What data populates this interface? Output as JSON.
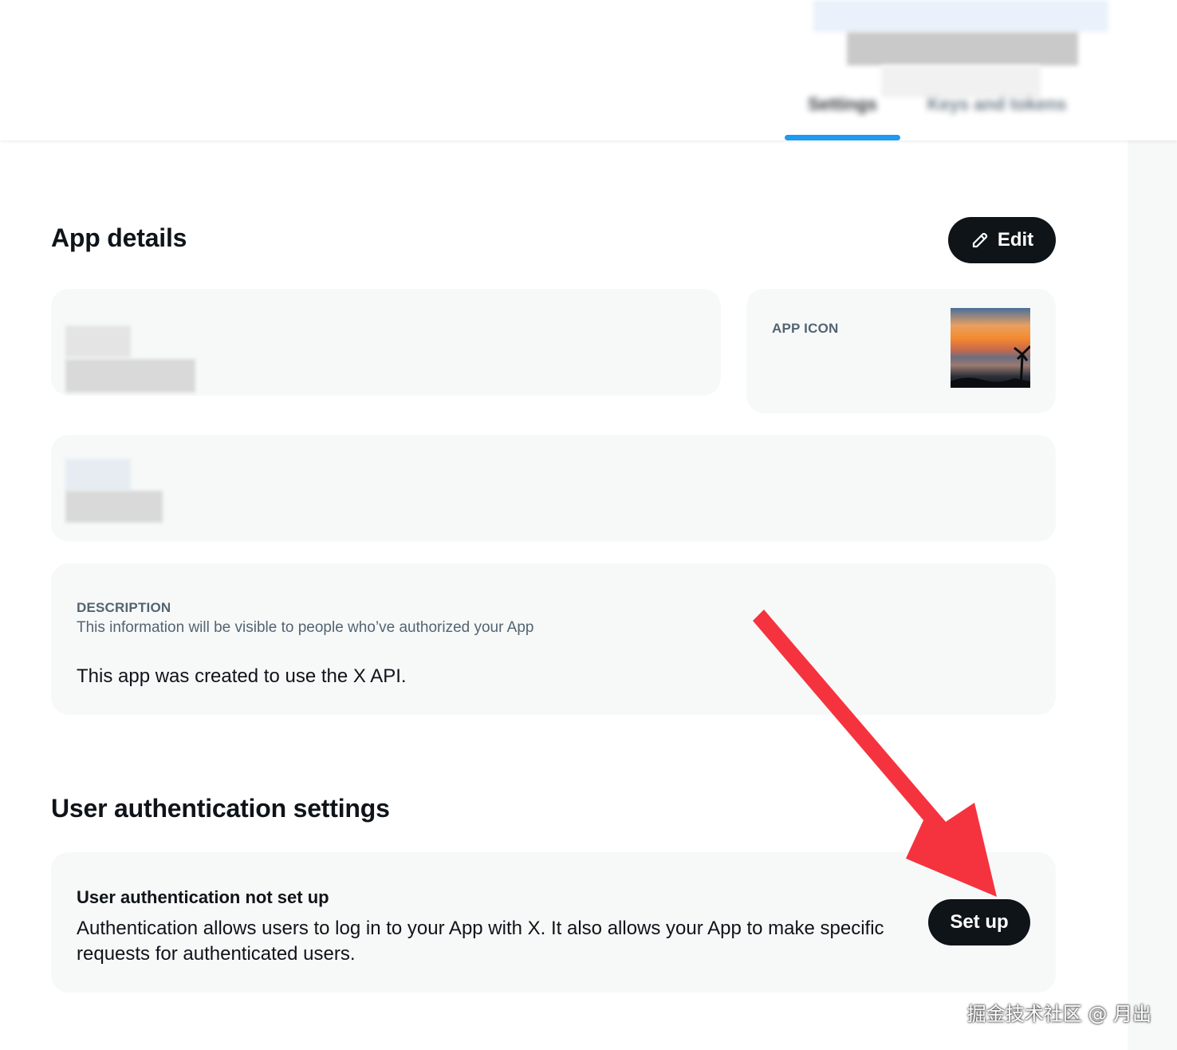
{
  "header": {
    "tabs": [
      {
        "label": "Settings",
        "active": true
      },
      {
        "label": "Keys and tokens",
        "active": false
      }
    ]
  },
  "app_details": {
    "title": "App details",
    "edit_label": "Edit",
    "app_icon_label": "APP ICON",
    "description": {
      "label": "DESCRIPTION",
      "hint": "This information will be visible to people who’ve authorized your App",
      "value": "This app was created to use the X API."
    }
  },
  "user_auth": {
    "title": "User authentication settings",
    "card_title": "User authentication not set up",
    "card_body": "Authentication allows users to log in to your App with X. It also allows your App to make specific requests for authenticated users.",
    "setup_label": "Set up"
  },
  "watermark": "掘金技术社区 @ 月出",
  "colors": {
    "accent": "#1d9bf0",
    "button": "#0f1419",
    "card": "#f7f9f9",
    "annotation_arrow": "#f5333f"
  }
}
